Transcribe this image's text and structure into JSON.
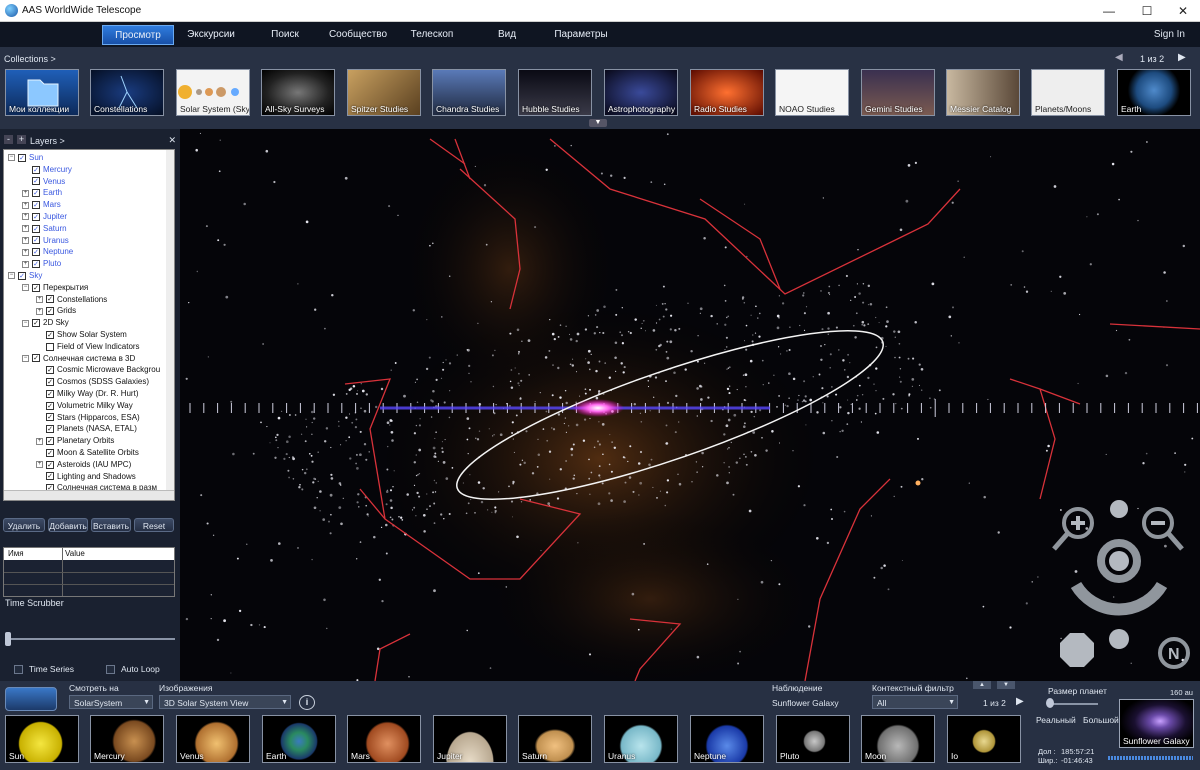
{
  "window": {
    "title": "AAS WorldWide Telescope",
    "minimize": "—",
    "maximize": "☐",
    "close": "✕"
  },
  "menu": {
    "items": [
      "Просмотр",
      "Экскурсии",
      "Поиск",
      "Сообщество",
      "Телескоп",
      "Вид",
      "Параметры"
    ],
    "signin": "Sign In"
  },
  "collections": {
    "label": "Collections  >",
    "page": "1 из 2",
    "prev": "◀",
    "next": "▶",
    "items": [
      "Мои коллекции",
      "Constellations",
      "Solar System (Sky)",
      "All-Sky Surveys",
      "Spitzer Studies",
      "Chandra Studies",
      "Hubble Studies",
      "Astrophotography",
      "Radio Studies",
      "NOAO Studies",
      "Gemini Studies",
      "Messier Catalog",
      "Planets/Moons",
      "Earth"
    ]
  },
  "layers": {
    "title": "Layers  >",
    "minus": "-",
    "plus": "+",
    "close": "✕",
    "tree": [
      {
        "label": "Sun",
        "level": 0,
        "exp": "−",
        "blue": true
      },
      {
        "label": "Mercury",
        "level": 1,
        "exp": "",
        "blue": true
      },
      {
        "label": "Venus",
        "level": 1,
        "exp": "",
        "blue": true
      },
      {
        "label": "Earth",
        "level": 1,
        "exp": "+",
        "blue": true
      },
      {
        "label": "Mars",
        "level": 1,
        "exp": "+",
        "blue": true
      },
      {
        "label": "Jupiter",
        "level": 1,
        "exp": "+",
        "blue": true
      },
      {
        "label": "Saturn",
        "level": 1,
        "exp": "+",
        "blue": true
      },
      {
        "label": "Uranus",
        "level": 1,
        "exp": "+",
        "blue": true
      },
      {
        "label": "Neptune",
        "level": 1,
        "exp": "+",
        "blue": true
      },
      {
        "label": "Pluto",
        "level": 1,
        "exp": "+",
        "blue": true
      },
      {
        "label": "Sky",
        "level": 0,
        "exp": "−",
        "blue": true
      },
      {
        "label": "Перекрытия",
        "level": 1,
        "exp": "−",
        "blue": false
      },
      {
        "label": "Constellations",
        "level": 2,
        "exp": "+",
        "blue": false
      },
      {
        "label": "Grids",
        "level": 2,
        "exp": "+",
        "blue": false
      },
      {
        "label": "2D Sky",
        "level": 1,
        "exp": "−",
        "blue": false
      },
      {
        "label": "Show Solar System",
        "level": 2,
        "exp": "",
        "blue": false
      },
      {
        "label": "Field of View Indicators",
        "level": 2,
        "exp": "",
        "blue": false,
        "unchecked": true
      },
      {
        "label": "Солнечная система в 3D",
        "level": 1,
        "exp": "−",
        "blue": false
      },
      {
        "label": "Cosmic Microwave Backgrou",
        "level": 2,
        "exp": "",
        "blue": false
      },
      {
        "label": "Cosmos (SDSS Galaxies)",
        "level": 2,
        "exp": "",
        "blue": false
      },
      {
        "label": "Milky Way (Dr. R. Hurt)",
        "level": 2,
        "exp": "",
        "blue": false
      },
      {
        "label": "Volumetric Milky Way",
        "level": 2,
        "exp": "",
        "blue": false
      },
      {
        "label": "Stars (Hipparcos, ESA)",
        "level": 2,
        "exp": "",
        "blue": false
      },
      {
        "label": "Planets (NASA, ETAL)",
        "level": 2,
        "exp": "",
        "blue": false
      },
      {
        "label": "Planetary Orbits",
        "level": 2,
        "exp": "+",
        "blue": false
      },
      {
        "label": "Moon & Satellite Orbits",
        "level": 2,
        "exp": "",
        "blue": false
      },
      {
        "label": "Asteroids (IAU MPC)",
        "level": 2,
        "exp": "+",
        "blue": false
      },
      {
        "label": "Lighting and Shadows",
        "level": 2,
        "exp": "",
        "blue": false
      },
      {
        "label": "Солнечная система в разм",
        "level": 2,
        "exp": "",
        "blue": false
      }
    ],
    "buttons": [
      "Удалить",
      "Добавить",
      "Вставить",
      "Reset"
    ],
    "table": {
      "col1": "Имя",
      "col2": "Value"
    },
    "time_scrubber": "Time Scrubber",
    "time_series": "Time Series",
    "auto_loop": "Auto Loop"
  },
  "bottom": {
    "look_at_label": "Смотреть на",
    "look_at_value": "SolarSystem",
    "imagery_label": "Изображения",
    "imagery_value": "3D Solar System View",
    "info": "i",
    "observing_label": "Наблюдение",
    "observing_value": "Sunflower Galaxy",
    "context_label": "Контекстный фильтр",
    "context_value": "All",
    "page": "1 из 2",
    "up": "▲",
    "down": "▼",
    "next": "▶",
    "planet_size_label": "Размер планет",
    "size_real": "Реальный",
    "size_large": "Большой",
    "scale": "160 au",
    "preview_name": "Sunflower Galaxy",
    "lon_label": "Дол :",
    "lon_value": "185:57:21",
    "lat_label": "Шир.:",
    "lat_value": "-01:46:43",
    "planets": [
      "Sun",
      "Mercury",
      "Venus",
      "Earth",
      "Mars",
      "Jupiter",
      "Saturn",
      "Uranus",
      "Neptune",
      "Pluto",
      "Moon",
      "Io"
    ]
  },
  "colors": {
    "accent": "#2f7cde",
    "constellation": "#d8323a",
    "orbit": "#f0f0f0",
    "ecliptic": "#7b5cff"
  }
}
